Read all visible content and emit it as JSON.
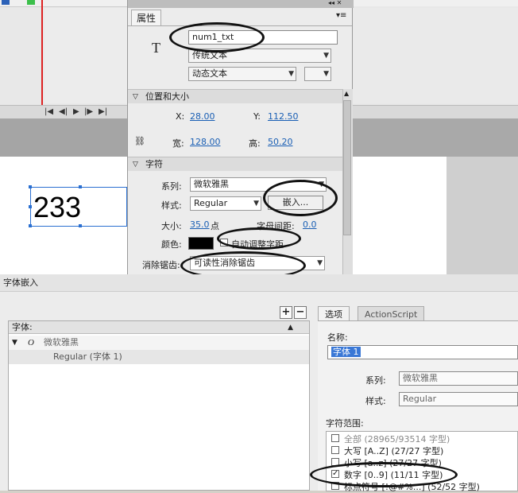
{
  "props": {
    "tab_label": "属性",
    "instance_name": "num1_txt",
    "text_engine": "传统文本",
    "text_type": "动态文本",
    "section_position": "位置和大小",
    "x_label": "X:",
    "x_value": "28.00",
    "y_label": "Y:",
    "y_value": "112.50",
    "width_label": "宽:",
    "width_value": "128.00",
    "height_label": "高:",
    "height_value": "50.20",
    "section_char": "字符",
    "family_label": "系列:",
    "family_value": "微软雅黑",
    "style_label": "样式:",
    "style_value": "Regular",
    "embed_label": "嵌入...",
    "size_label": "大小:",
    "size_value": "35.0",
    "size_unit": "点",
    "spacing_label": "字母间距:",
    "spacing_value": "0.0",
    "color_label": "颜色:",
    "color_value": "#000000",
    "autokern_label": "自动调整字距",
    "antialias_label": "消除锯齿:",
    "antialias_value": "可读性消除锯齿"
  },
  "stage": {
    "text_content": "233"
  },
  "dialog": {
    "title": "字体嵌入",
    "add_label": "+",
    "remove_label": "−",
    "list_header": "字体:",
    "font_family": "微软雅黑",
    "font_entry": "Regular (字体 1)",
    "tabs": [
      "选项",
      "ActionScript"
    ],
    "name_label": "名称:",
    "name_value": "字体 1",
    "family_label": "系列:",
    "family_value": "微软雅黑",
    "style_label": "样式:",
    "style_value": "Regular",
    "range_label": "字符范围:",
    "ranges": [
      {
        "label": "全部",
        "detail": "(28965/93514 字型)",
        "checked": false
      },
      {
        "label": "大写 [A..Z]",
        "detail": "(27/27 字型)",
        "checked": false
      },
      {
        "label": "小写 [a..z]",
        "detail": "(27/27 字型)",
        "checked": false
      },
      {
        "label": "数字 [0..9]",
        "detail": "(11/11 字型)",
        "checked": true
      },
      {
        "label": "标点符号 [!@#%...]",
        "detail": "(52/52 字型)",
        "checked": false
      }
    ]
  },
  "colors": {
    "link": "#1a5fb4",
    "selection": "#2a6fd1",
    "playhead": "#d22222"
  }
}
